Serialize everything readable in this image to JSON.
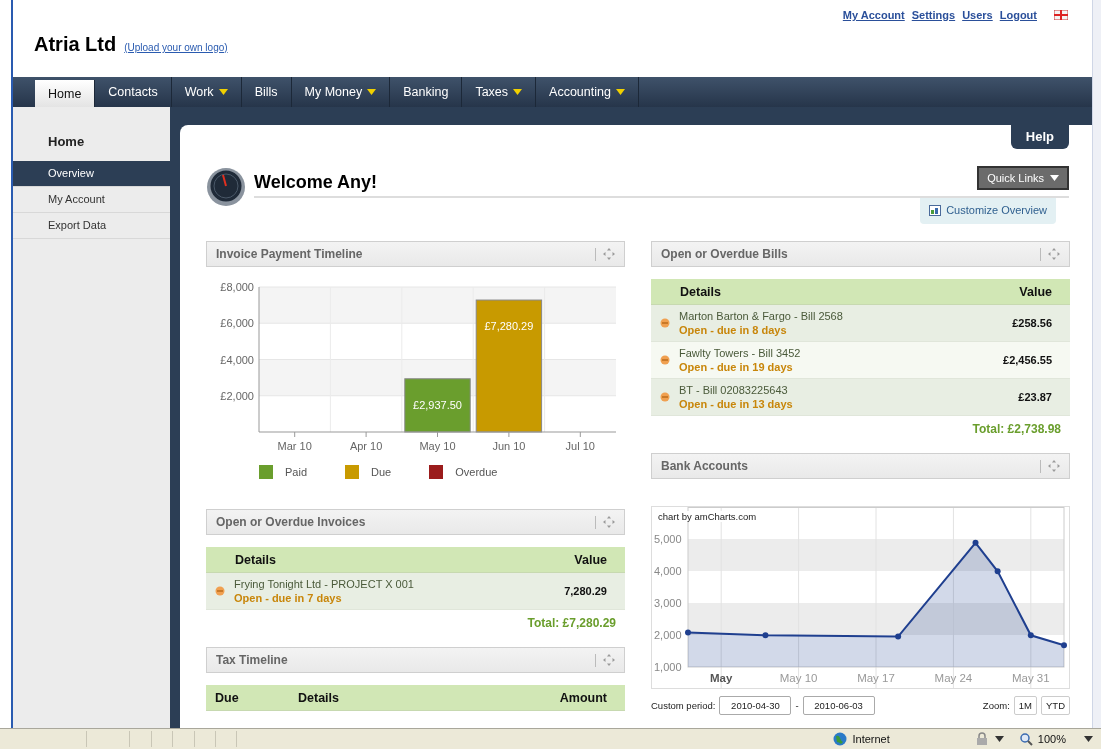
{
  "header": {
    "company": "Atria Ltd",
    "logo_link": "(Upload your own logo)",
    "account_links": [
      "My Account",
      "Settings",
      "Users",
      "Logout"
    ]
  },
  "nav": [
    {
      "label": "Home",
      "selected": true,
      "dropdown": false
    },
    {
      "label": "Contacts",
      "selected": false,
      "dropdown": false
    },
    {
      "label": "Work",
      "selected": false,
      "dropdown": true
    },
    {
      "label": "Bills",
      "selected": false,
      "dropdown": false
    },
    {
      "label": "My Money",
      "selected": false,
      "dropdown": true
    },
    {
      "label": "Banking",
      "selected": false,
      "dropdown": false
    },
    {
      "label": "Taxes",
      "selected": false,
      "dropdown": true
    },
    {
      "label": "Accounting",
      "selected": false,
      "dropdown": true
    }
  ],
  "sidebar": {
    "title": "Home",
    "items": [
      {
        "label": "Overview",
        "selected": true
      },
      {
        "label": "My Account",
        "selected": false
      },
      {
        "label": "Export Data",
        "selected": false
      }
    ]
  },
  "help": "Help",
  "welcome": "Welcome Any!",
  "quick_links": "Quick Links",
  "customize": "Customize Overview",
  "invoice_timeline": {
    "title": "Invoice Payment Timeline",
    "chart_data": {
      "type": "bar",
      "stacked": true,
      "grid": true,
      "categories": [
        "Mar 10",
        "Apr 10",
        "May 10",
        "Jun 10",
        "Jul 10"
      ],
      "ylim": [
        0,
        8000
      ],
      "yticks": [
        {
          "value": 2000,
          "label": "£2,000"
        },
        {
          "value": 4000,
          "label": "£4,000"
        },
        {
          "value": 6000,
          "label": "£6,000"
        },
        {
          "value": 8000,
          "label": "£8,000"
        }
      ],
      "series": [
        {
          "name": "Paid",
          "color": "#6a9e2d",
          "values": [
            null,
            null,
            2937.5,
            null,
            null
          ],
          "value_labels": [
            null,
            null,
            "£2,937.50",
            null,
            null
          ]
        },
        {
          "name": "Due",
          "color": "#c89a00",
          "values": [
            null,
            null,
            null,
            7280.29,
            null
          ],
          "value_labels": [
            null,
            null,
            null,
            "£7,280.29",
            null
          ]
        },
        {
          "name": "Overdue",
          "color": "#9b1c1c",
          "values": [
            null,
            null,
            null,
            null,
            null
          ]
        }
      ]
    }
  },
  "open_invoices": {
    "title": "Open or Overdue Invoices",
    "columns": [
      "Details",
      "Value"
    ],
    "rows": [
      {
        "name": "Frying Tonight Ltd - PROJECT X 001",
        "status": "Open - due in 7 days",
        "value": "7,280.29"
      }
    ],
    "total": "Total: £7,280.29"
  },
  "tax_timeline": {
    "title": "Tax Timeline",
    "columns": [
      "Due",
      "Details",
      "Amount"
    ]
  },
  "open_bills": {
    "title": "Open or Overdue Bills",
    "columns": [
      "Details",
      "Value"
    ],
    "rows": [
      {
        "name": "Marton Barton & Fargo - Bill 2568",
        "status": "Open - due in 8 days",
        "value": "£258.56"
      },
      {
        "name": "Fawlty Towers - Bill 3452",
        "status": "Open - due in 19 days",
        "value": "£2,456.55"
      },
      {
        "name": "BT - Bill 02083225643",
        "status": "Open - due in 13 days",
        "value": "£23.87"
      }
    ],
    "total": "Total: £2,738.98"
  },
  "bank_accounts": {
    "title": "Bank Accounts",
    "credit": "chart by amCharts.com",
    "chart_data": {
      "type": "area",
      "grid": true,
      "xlim": [
        "2010-04-30",
        "2010-06-03"
      ],
      "ylim": [
        1000,
        6000
      ],
      "bands": [
        {
          "axis": "y",
          "from": 2000,
          "to": 3000
        },
        {
          "axis": "y",
          "from": 4000,
          "to": 5000
        }
      ],
      "x": [
        "2010-04-30",
        "2010-05-07",
        "2010-05-19",
        "2010-05-26",
        "2010-05-28",
        "2010-05-31",
        "2010-06-03"
      ],
      "xticks": [
        {
          "value": "2010-05-03",
          "label": "May"
        },
        {
          "value": "2010-05-10",
          "label": "May 10"
        },
        {
          "value": "2010-05-17",
          "label": "May 17"
        },
        {
          "value": "2010-05-24",
          "label": "May 24"
        },
        {
          "value": "2010-05-31",
          "label": "May 31"
        }
      ],
      "yticks": [
        {
          "value": 1000,
          "label": "1,000"
        },
        {
          "value": 2000,
          "label": "2,000"
        },
        {
          "value": 3000,
          "label": "3,000"
        },
        {
          "value": 4000,
          "label": "4,000"
        },
        {
          "value": 5000,
          "label": "5,000"
        }
      ],
      "series": [
        {
          "color": "#1f3f8f",
          "values": [
            2080,
            1990,
            1950,
            4880,
            3990,
            1990,
            1680
          ]
        }
      ]
    },
    "period_label": "Custom period:",
    "period_from": "2010-04-30",
    "period_separator": "-",
    "period_to": "2010-06-03",
    "zoom_label": "Zoom:",
    "zoom_buttons": [
      "1M",
      "YTD"
    ]
  },
  "status_bar": {
    "zone": "Internet",
    "zoom": "100%"
  }
}
